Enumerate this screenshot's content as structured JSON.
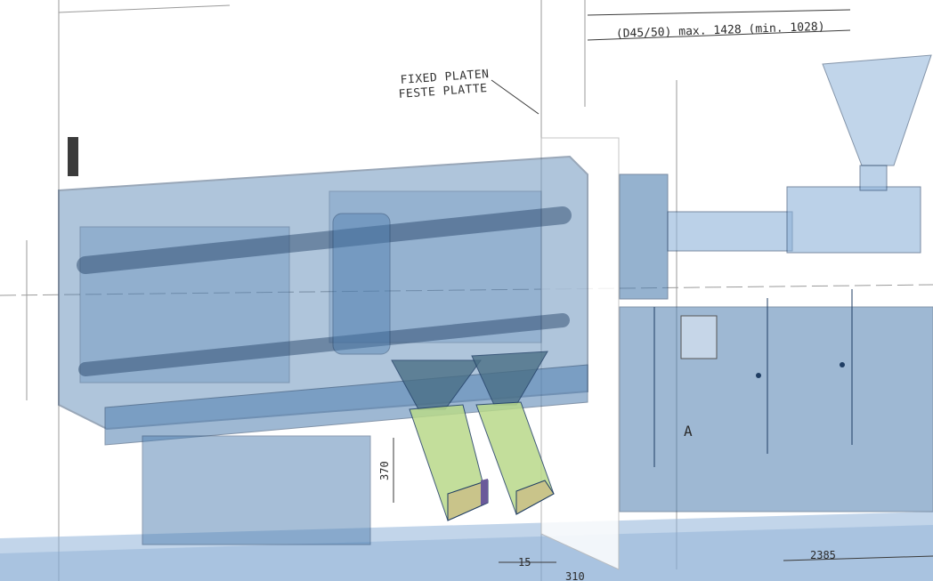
{
  "drawing": {
    "labels": {
      "fixed_platen_en": "FIXED PLATEN",
      "fixed_platen_de": "FESTE PLATTE",
      "section_marker": "A"
    },
    "dimensions": {
      "nozzle_travel": "(D45/50) max. 1428 (min. 1028)",
      "base_height": "370",
      "offset_small": "15",
      "offset_partial": "310",
      "overall_length": "2385"
    }
  },
  "colors": {
    "machine_fill": "#4f7fb0",
    "machine_stroke": "#1f3d63",
    "floor": "#8fb3d9",
    "chute_green": "#b9d98a",
    "chute_olive": "#c9c48a",
    "chute_purple": "#6a5a9a",
    "line_art": "#3a3a3a"
  }
}
